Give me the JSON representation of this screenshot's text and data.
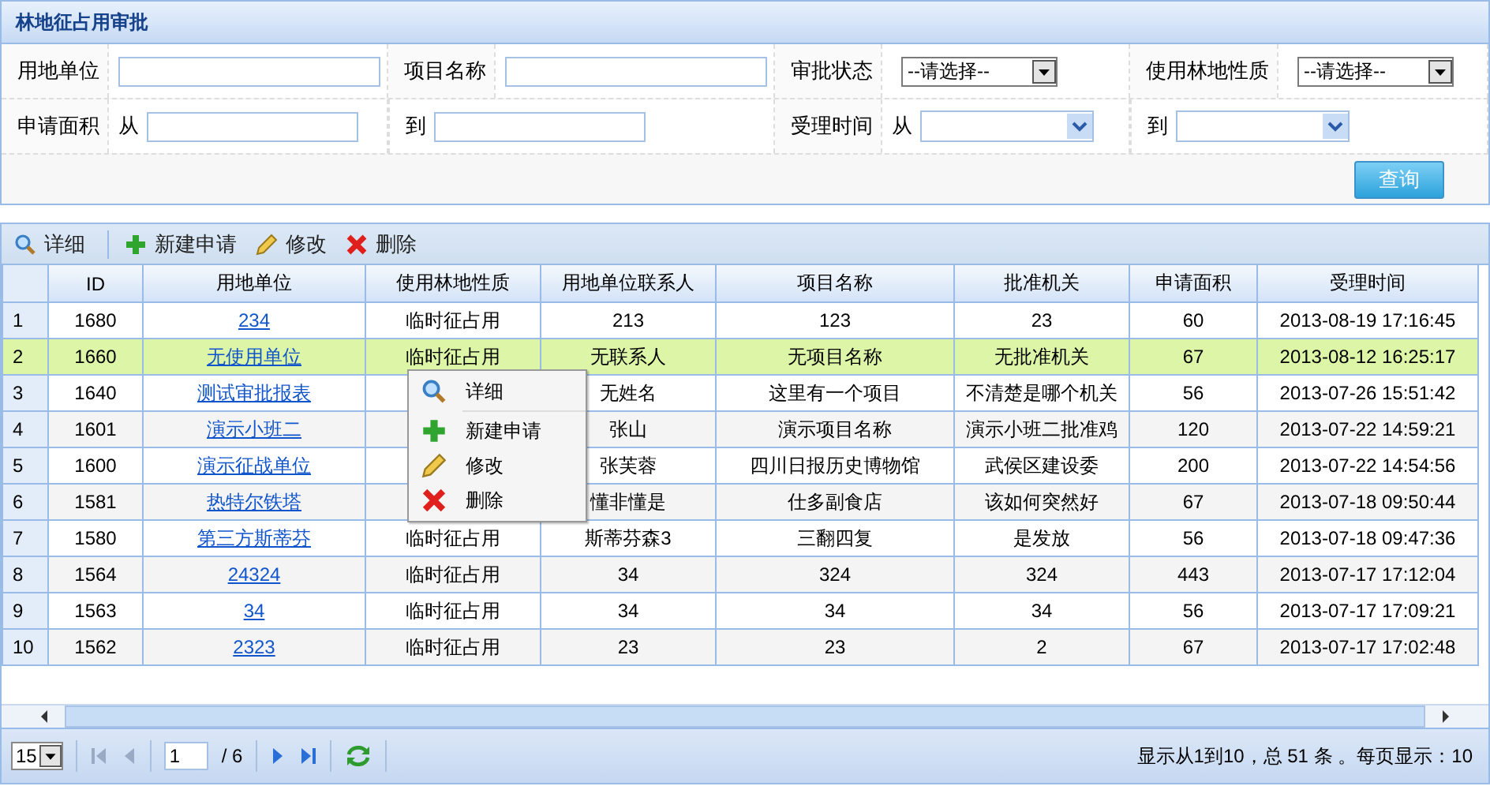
{
  "panel": {
    "title": "林地征占用审批"
  },
  "search_form": {
    "rows": [
      [
        {
          "kind": "text",
          "label": "用地单位"
        },
        {
          "kind": "text",
          "label": "项目名称"
        },
        {
          "kind": "select",
          "label": "审批状态",
          "value": "--请选择--"
        },
        {
          "kind": "select",
          "label": "使用林地性质",
          "value": "--请选择--"
        }
      ],
      [
        {
          "kind": "range_from",
          "label": "申请面积",
          "prefix": "从"
        },
        {
          "kind": "range_to",
          "label": "到"
        },
        {
          "kind": "date_from",
          "label": "受理时间",
          "prefix": "从"
        },
        {
          "kind": "date_to",
          "label": "到"
        }
      ]
    ],
    "button": "查询"
  },
  "toolbar": [
    "详细",
    "新建申请",
    "修改",
    "删除"
  ],
  "table": {
    "columns": [
      {
        "label": "ID",
        "kind": "text"
      },
      {
        "label": "用地单位",
        "kind": "link"
      },
      {
        "label": "使用林地性质",
        "kind": "text"
      },
      {
        "label": "用地单位联系人",
        "kind": "text"
      },
      {
        "label": "项目名称",
        "kind": "text"
      },
      {
        "label": "批准机关",
        "kind": "text"
      },
      {
        "label": "申请面积",
        "kind": "text"
      },
      {
        "label": "受理时间",
        "kind": "text"
      }
    ],
    "rows": [
      {
        "row_number": "1",
        "selected": false,
        "cells": [
          "1680",
          "234",
          "临时征占用",
          "213",
          "123",
          "23",
          "60",
          "2013-08-19 17:16:45"
        ]
      },
      {
        "row_number": "2",
        "selected": true,
        "cells": [
          "1660",
          "无使用单位",
          "临时征占用",
          "无联系人",
          "无项目名称",
          "无批准机关",
          "67",
          "2013-08-12 16:25:17"
        ]
      },
      {
        "row_number": "3",
        "selected": false,
        "cells": [
          "1640",
          "测试审批报表",
          null,
          "无姓名",
          "这里有一个项目",
          "不清楚是哪个机关",
          "56",
          "2013-07-26 15:51:42"
        ]
      },
      {
        "row_number": "4",
        "selected": false,
        "cells": [
          "1601",
          "演示小班二",
          null,
          "张山",
          "演示项目名称",
          "演示小班二批准鸡",
          "120",
          "2013-07-22 14:59:21"
        ]
      },
      {
        "row_number": "5",
        "selected": false,
        "cells": [
          "1600",
          "演示征战单位",
          null,
          "张芙蓉",
          "四川日报历史博物馆",
          "武侯区建设委",
          "200",
          "2013-07-22 14:54:56"
        ]
      },
      {
        "row_number": "6",
        "selected": false,
        "cells": [
          "1581",
          "热特尔铁塔",
          null,
          "懂非懂是",
          "仕多副食店",
          "该如何突然好",
          "67",
          "2013-07-18 09:50:44"
        ]
      },
      {
        "row_number": "7",
        "selected": false,
        "cells": [
          "1580",
          "第三方斯蒂芬",
          "临时征占用",
          "斯蒂芬森3",
          "三翻四复",
          "是发放",
          "56",
          "2013-07-18 09:47:36"
        ]
      },
      {
        "row_number": "8",
        "selected": false,
        "cells": [
          "1564",
          "24324",
          "临时征占用",
          "34",
          "324",
          "324",
          "443",
          "2013-07-17 17:12:04"
        ]
      },
      {
        "row_number": "9",
        "selected": false,
        "cells": [
          "1563",
          "34",
          "临时征占用",
          "34",
          "34",
          "34",
          "56",
          "2013-07-17 17:09:21"
        ]
      },
      {
        "row_number": "10",
        "selected": false,
        "cells": [
          "1562",
          "2323",
          "临时征占用",
          "23",
          "23",
          "2",
          "67",
          "2013-07-17 17:02:48"
        ]
      }
    ]
  },
  "context_menu": [
    "详细",
    "新建申请",
    "修改",
    "删除"
  ],
  "pager": {
    "page_size": "15",
    "page": "1",
    "total_pages": "/ 6",
    "info": "显示从1到10，总 51 条 。每页显示：10"
  }
}
